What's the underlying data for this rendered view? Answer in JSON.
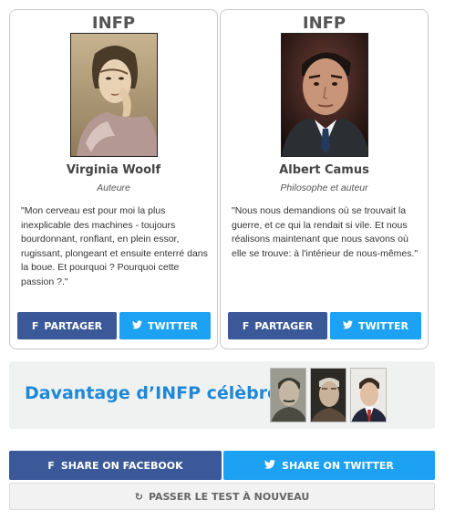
{
  "cards": [
    {
      "type": "INFP",
      "name": "Virginia Woolf",
      "role": "Auteure",
      "quote": "\"Mon cerveau est pour moi la plus inexplicable des machines - toujours bourdonnant, ronflant, en plein essor, rugissant, plongeant et ensuite enterré dans la boue. Et pourquoi ? Pourquoi cette passion ?.\"",
      "share_label": "PARTAGER",
      "tweet_label": "TWITTER"
    },
    {
      "type": "INFP",
      "name": "Albert Camus",
      "role": "Philosophe et auteur",
      "quote": "\"Nous nous demandions où se trouvait la guerre, et ce qui la rendait si vile. Et nous réalisons maintenant que nous savons où elle se trouve: à l'intérieur de nous-mêmes.\"",
      "share_label": "PARTAGER",
      "tweet_label": "TWITTER"
    }
  ],
  "more": {
    "title": "Davantage d’INFP célèbres"
  },
  "share": {
    "facebook_label": "SHARE ON FACEBOOK",
    "twitter_label": "SHARE ON TWITTER",
    "retake_label": "PASSER LE TEST À NOUVEAU"
  },
  "icons": {
    "facebook": "facebook-icon",
    "twitter": "twitter-icon",
    "retake": "refresh-icon"
  },
  "colors": {
    "facebook": "#3b5998",
    "twitter": "#1da1f2",
    "link_blue": "#1e88d8"
  }
}
